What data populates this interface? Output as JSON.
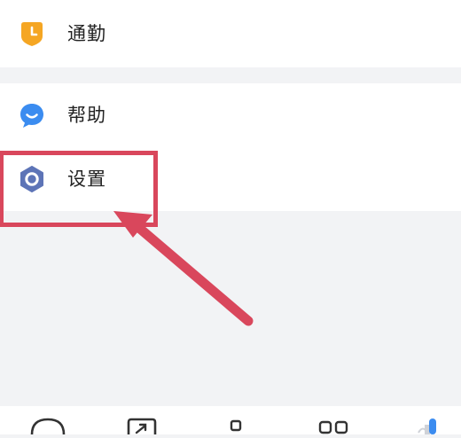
{
  "menu": {
    "commute": {
      "label": "通勤",
      "icon": "clock-icon",
      "icon_color": "#f5a623"
    },
    "help": {
      "label": "帮助",
      "icon": "chat-bubble-icon",
      "icon_color": "#3b8cf0"
    },
    "settings": {
      "label": "设置",
      "icon": "hexagon-settings-icon",
      "icon_color": "#5d74b7"
    }
  },
  "annotation": {
    "color": "#d9475c",
    "target": "settings"
  },
  "tabbar": {
    "tabs": [
      {
        "icon": "chat-icon"
      },
      {
        "icon": "share-icon"
      },
      {
        "icon": "square-icon"
      },
      {
        "icon": "apps-icon"
      },
      {
        "icon": "profile-icon",
        "active_color": "#3b8cf0"
      }
    ]
  }
}
